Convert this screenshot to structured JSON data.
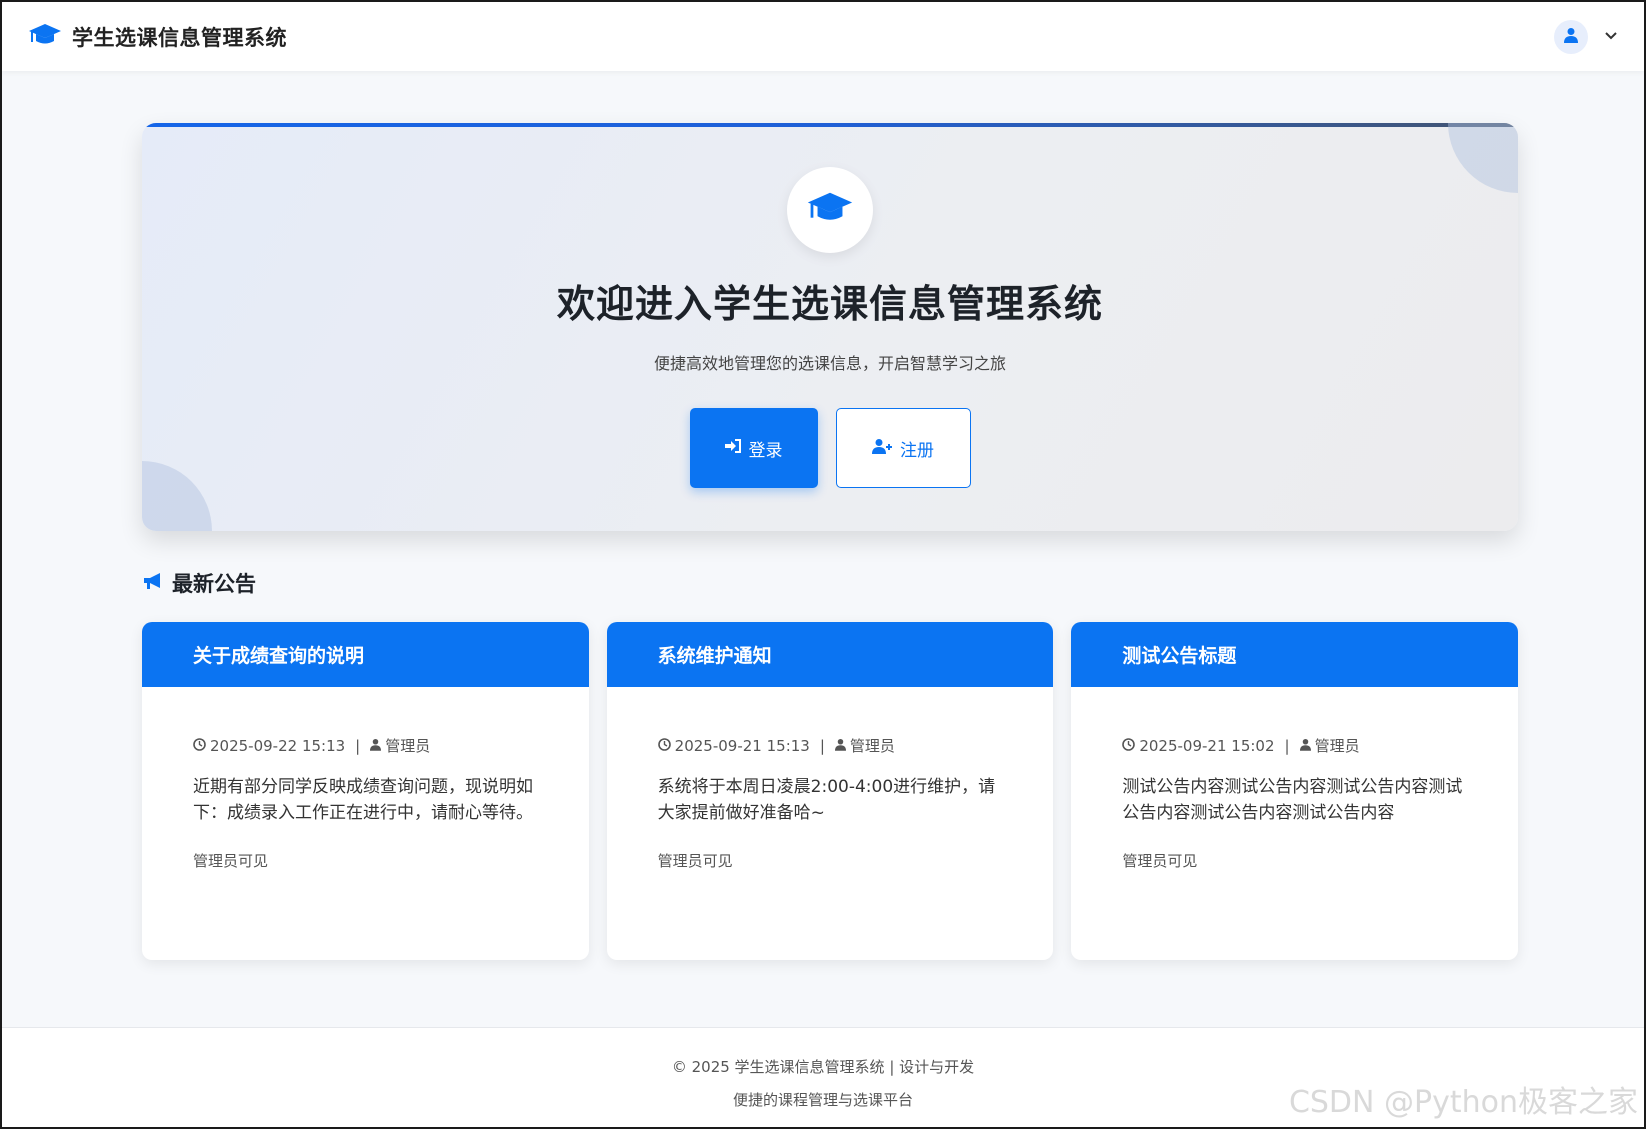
{
  "navbar": {
    "title": "学生选课信息管理系统",
    "brand_icon": "graduation-cap-icon",
    "avatar_icon": "user-icon",
    "menu_icon": "chevron-down-icon"
  },
  "hero": {
    "title": "欢迎进入学生选课信息管理系统",
    "subtitle": "便捷高效地管理您的选课信息，开启智慧学习之旅",
    "login_label": "登录",
    "register_label": "注册"
  },
  "announcements": {
    "title": "最新公告",
    "items": [
      {
        "title": "关于成绩查询的说明",
        "date": "2025-09-22 15:13",
        "author": "管理员",
        "content": "近期有部分同学反映成绩查询问题，现说明如下：成绩录入工作正在进行中，请耐心等待。",
        "visibility": "管理员可见"
      },
      {
        "title": "系统维护通知",
        "date": "2025-09-21 15:13",
        "author": "管理员",
        "content": "系统将于本周日凌晨2:00-4:00进行维护，请大家提前做好准备哈~",
        "visibility": "管理员可见"
      },
      {
        "title": "测试公告标题",
        "date": "2025-09-21 15:02",
        "author": "管理员",
        "content": "测试公告内容测试公告内容测试公告内容测试公告内容测试公告内容测试公告内容",
        "visibility": "管理员可见"
      }
    ]
  },
  "footer": {
    "line1": "© 2025 学生选课信息管理系统 | 设计与开发",
    "line2": "便捷的课程管理与选课平台"
  },
  "watermark": "CSDN @Python极客之家",
  "colors": {
    "primary": "#0b74f2",
    "text_dark": "#1d2229"
  }
}
